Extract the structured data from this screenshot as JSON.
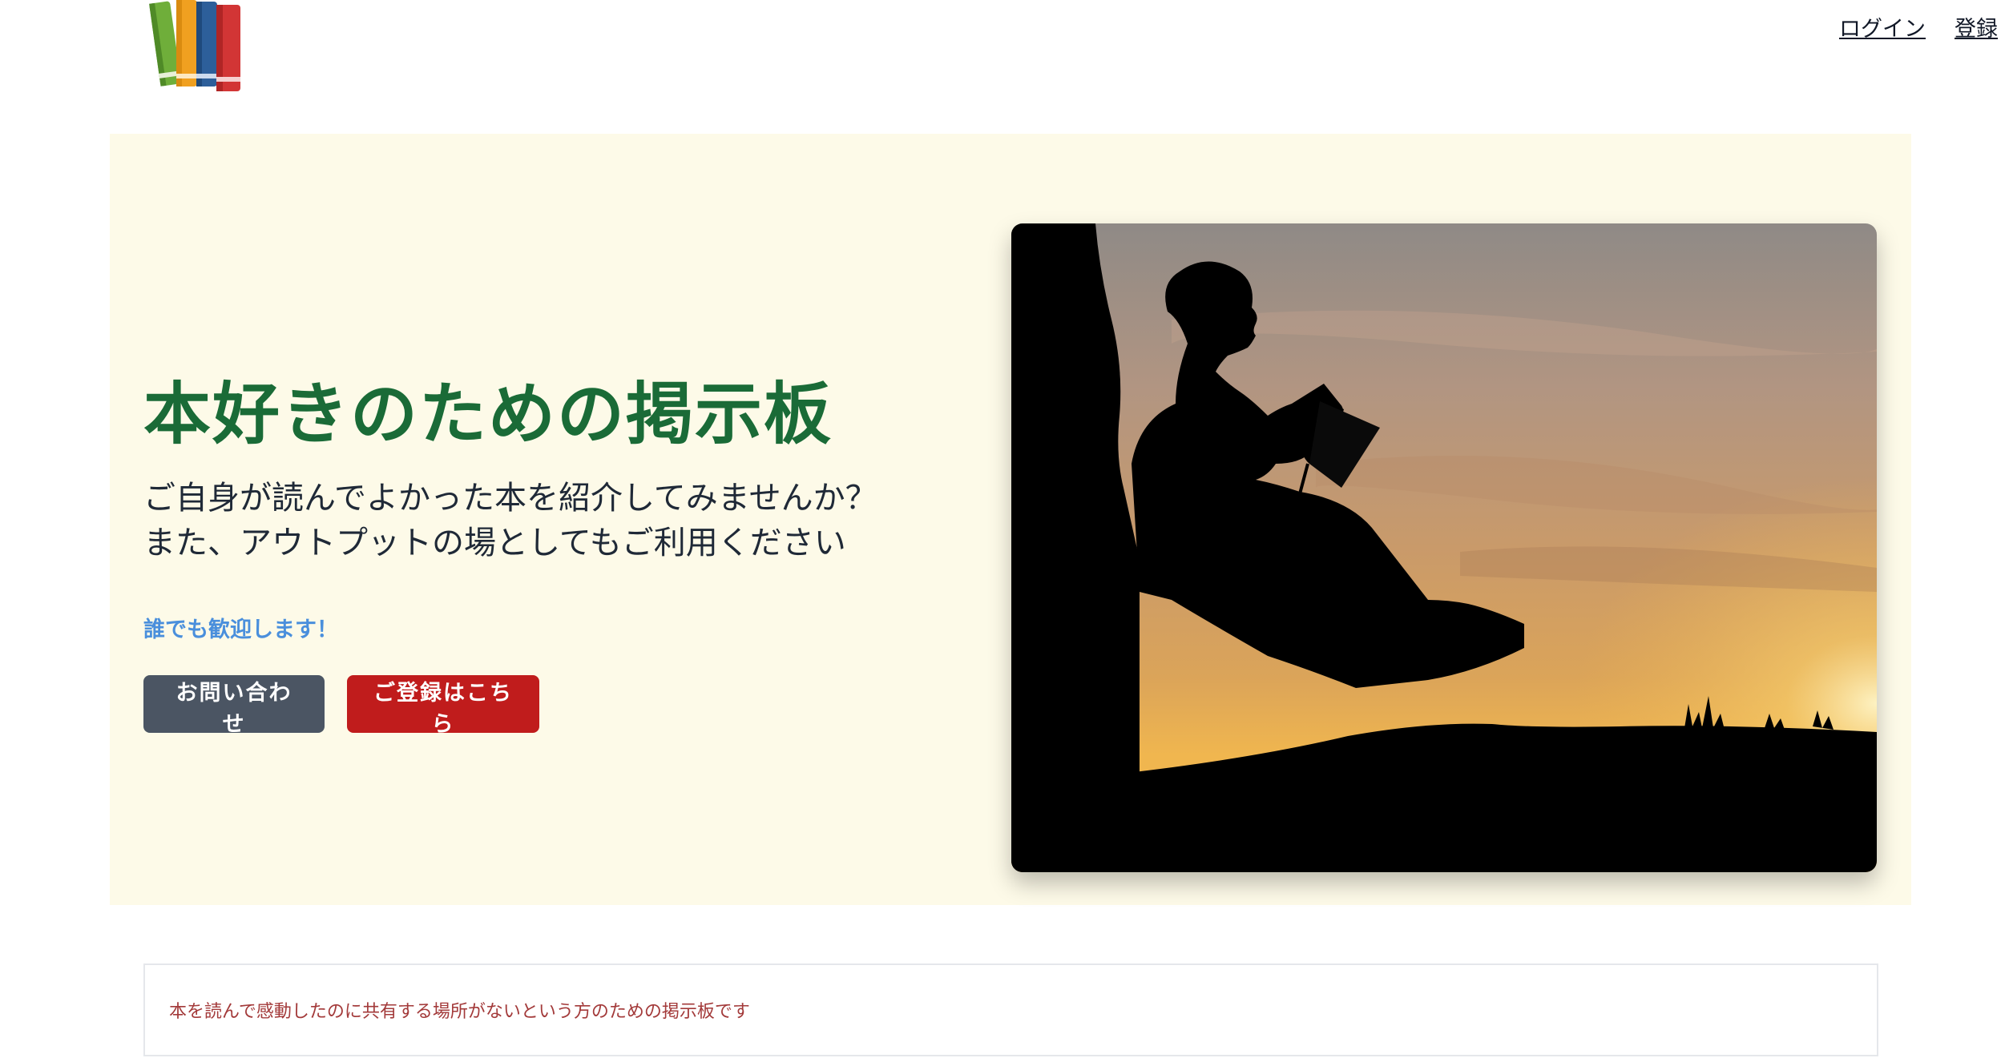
{
  "header": {
    "logo_icon": "books-icon",
    "nav": {
      "login": "ログイン",
      "register": "登録"
    }
  },
  "hero": {
    "title": "本好きのための掲示板",
    "subtitle_line1": "ご自身が読んでよかった本を紹介してみませんか？",
    "subtitle_line2": "また、アウトプットの場としてもご利用ください",
    "note": "誰でも歓迎します！",
    "buttons": {
      "contact": "お問い合わせ",
      "signup": "ご登録はこちら"
    },
    "image_icon": "reading-silhouette-image"
  },
  "about": {
    "text": "本を読んで感動したのに共有する場所がないという方のための掲示板です"
  },
  "colors": {
    "title_green": "#1a6b37",
    "note_blue": "#4a8fdc",
    "button_gray": "#4b5563",
    "button_red": "#c01c1c",
    "hero_background": "#fdfae8",
    "about_text": "#a33a3a"
  }
}
